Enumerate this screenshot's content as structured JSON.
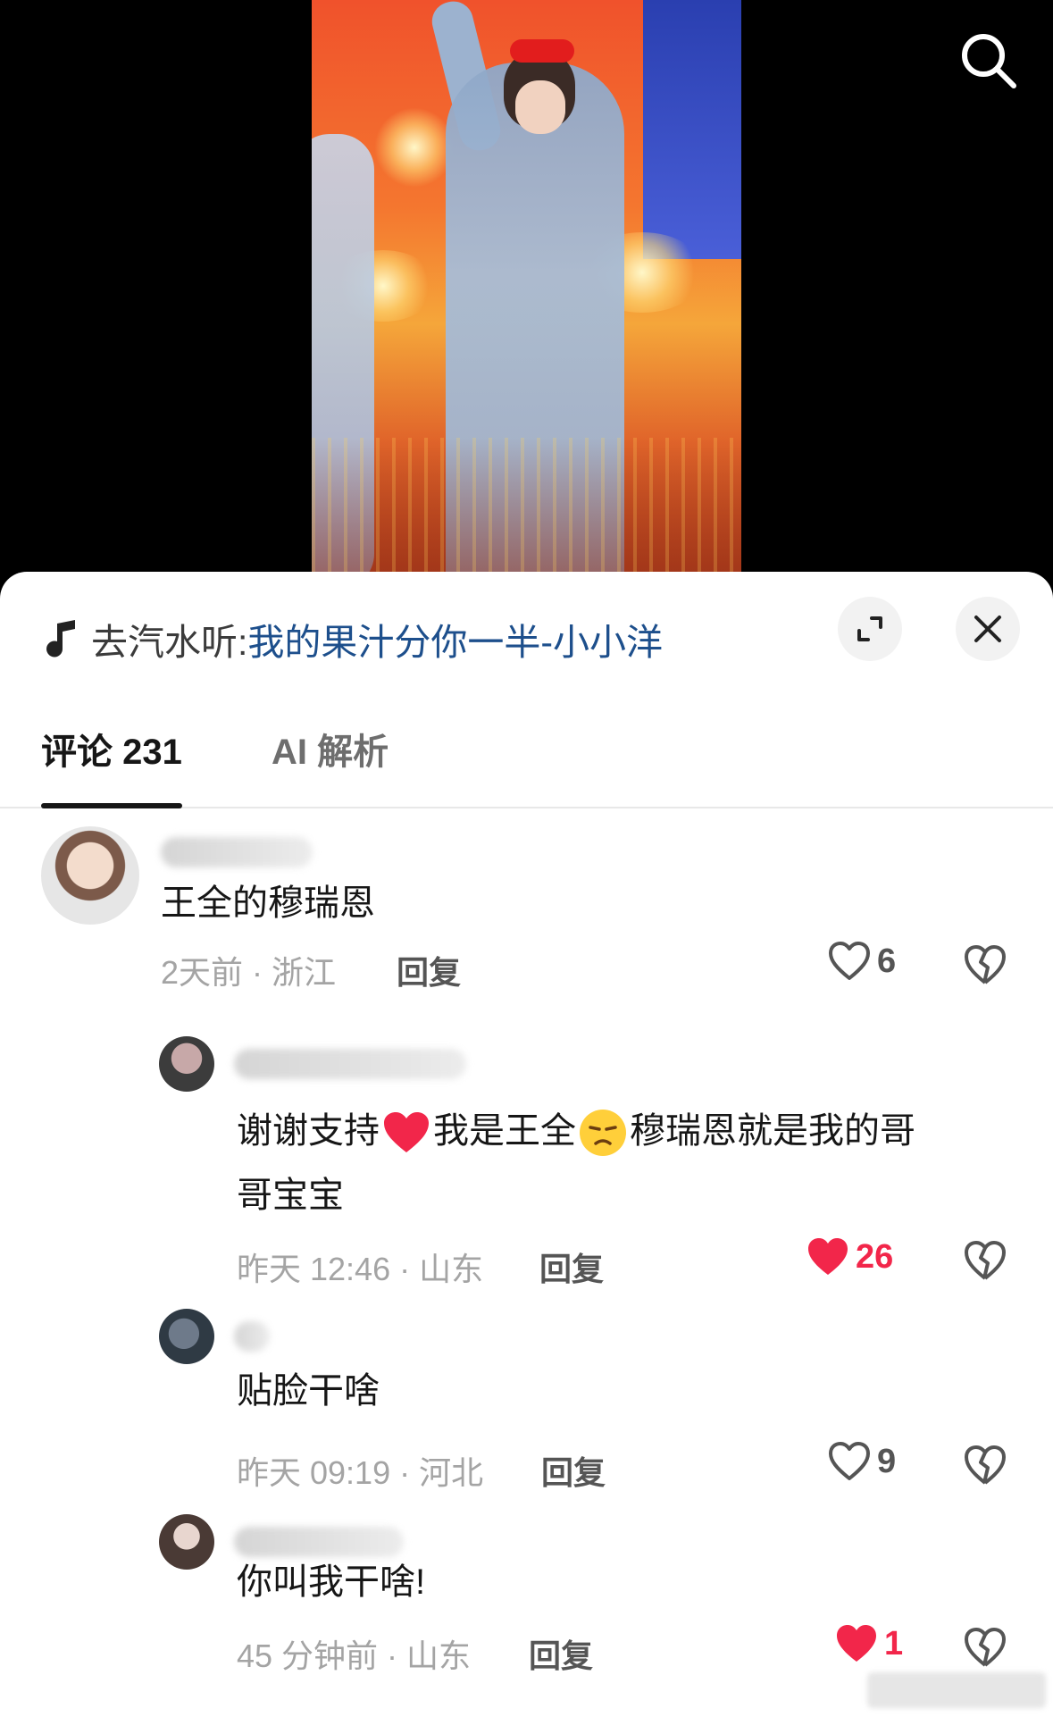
{
  "video": {
    "search_icon": "search-icon"
  },
  "sheet": {
    "music_prefix": "去汽水听:",
    "music_song": "我的果汁分你一半-小小洋",
    "expand_icon": "expand-icon",
    "close_icon": "close-icon"
  },
  "tabs": [
    {
      "label": "评论 231",
      "active": true
    },
    {
      "label": "AI 解析",
      "active": false
    }
  ],
  "comments": [
    {
      "text": "王全的穆瑞恩",
      "meta": "2天前 · 浙江",
      "reply_label": "回复",
      "likes": "6",
      "liked": false
    },
    {
      "text_parts": [
        "谢谢支持",
        "我是王全",
        "穆瑞恩就是我的哥",
        "哥宝宝"
      ],
      "meta": "昨天 12:46 · 山东",
      "reply_label": "回复",
      "likes": "26",
      "liked": true
    },
    {
      "text": "贴脸干啥",
      "meta": "昨天 09:19 · 河北",
      "reply_label": "回复",
      "likes": "9",
      "liked": false
    },
    {
      "text": "你叫我干啥!",
      "meta": "45 分钟前 · 山东",
      "reply_label": "回复",
      "likes": "1",
      "liked": true
    }
  ],
  "colors": {
    "accent_red": "#f2264a",
    "link_blue": "#1d4f8c"
  }
}
